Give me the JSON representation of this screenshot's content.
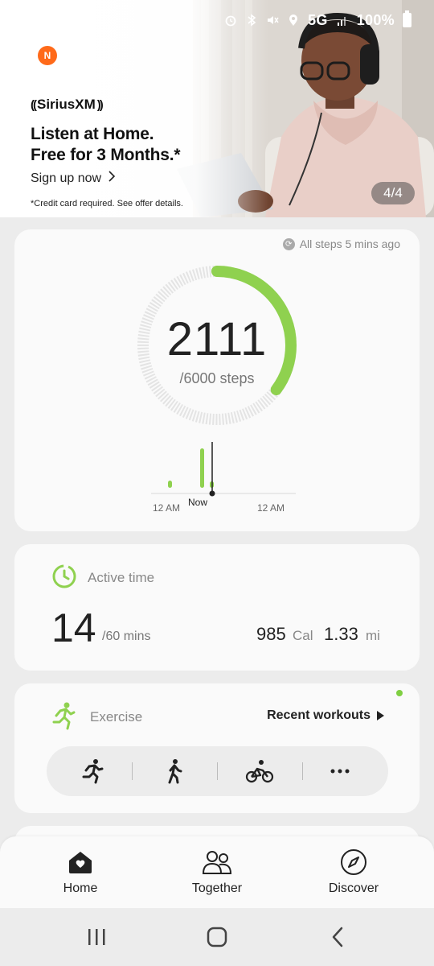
{
  "status_bar": {
    "network": "5G",
    "battery": "100%",
    "icons": [
      "alarm-icon",
      "bluetooth-icon",
      "mute-icon",
      "location-icon",
      "signal-icon",
      "battery-icon"
    ]
  },
  "banner": {
    "notification_badge": "N",
    "brand": "SiriusXM",
    "headline_line1": "Listen at Home.",
    "headline_line2": "Free for 3 Months.*",
    "cta_label": "Sign up now",
    "disclaimer": "*Credit card required. See offer details.",
    "pager": "4/4"
  },
  "steps": {
    "sync_text": "All steps 5 mins ago",
    "count": "2111",
    "goal_text": "/6000 steps",
    "progress": 0.352,
    "chart": {
      "start_label": "12 AM",
      "now_label": "Now",
      "end_label": "12 AM"
    }
  },
  "active_time": {
    "title": "Active time",
    "value": "14",
    "goal": "/60 mins",
    "calories_value": "985",
    "calories_unit": "Cal",
    "distance_value": "1.33",
    "distance_unit": "mi"
  },
  "exercise": {
    "title": "Exercise",
    "recent_label": "Recent workouts",
    "workouts": [
      "running-icon",
      "walking-icon",
      "cycling-icon",
      "more-icon"
    ]
  },
  "bottom_nav": {
    "items": [
      {
        "label": "Home",
        "icon": "home-icon"
      },
      {
        "label": "Together",
        "icon": "together-icon"
      },
      {
        "label": "Discover",
        "icon": "compass-icon"
      }
    ]
  },
  "colors": {
    "accent_green": "#8fd14f",
    "ring_track": "#e2e2e2",
    "card_bg": "#fafafa",
    "page_bg": "#ececec"
  }
}
